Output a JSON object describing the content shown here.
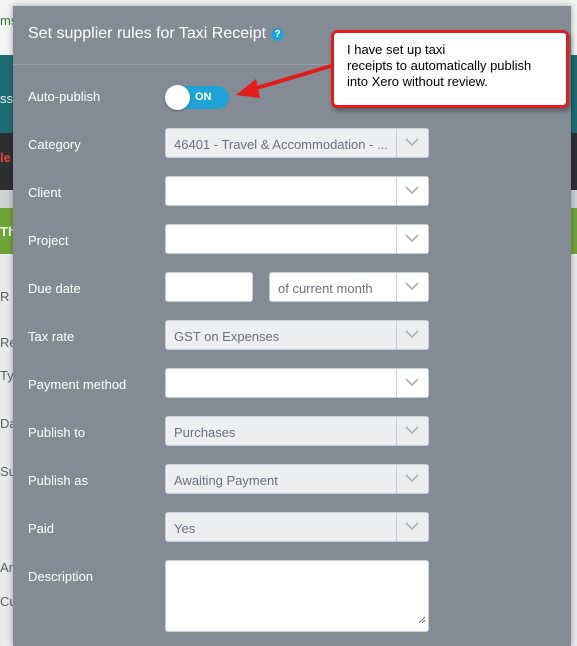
{
  "background": {
    "fragments": [
      "ms",
      "ss",
      "le",
      "Th",
      "R",
      "Re",
      "Typ",
      "Da",
      "Su",
      "An",
      "Cu"
    ]
  },
  "modal": {
    "title": "Set supplier rules for Taxi Receipt",
    "help_glyph": "?",
    "fields": {
      "auto_publish": {
        "label": "Auto-publish",
        "state": "ON"
      },
      "category": {
        "label": "Category",
        "value": "46401 - Travel & Accommodation - ..."
      },
      "client": {
        "label": "Client",
        "value": ""
      },
      "project": {
        "label": "Project",
        "value": ""
      },
      "due_date": {
        "label": "Due date",
        "value": "",
        "period": "of current month"
      },
      "tax_rate": {
        "label": "Tax rate",
        "value": "GST on Expenses"
      },
      "payment_method": {
        "label": "Payment method",
        "value": ""
      },
      "publish_to": {
        "label": "Publish to",
        "value": "Purchases"
      },
      "publish_as": {
        "label": "Publish as",
        "value": "Awaiting Payment"
      },
      "paid": {
        "label": "Paid",
        "value": "Yes"
      },
      "description": {
        "label": "Description",
        "value": ""
      }
    }
  },
  "callout": {
    "line1": "I have set up taxi",
    "line2": "receipts to automatically publish",
    "line3": "into Xero without review."
  },
  "colors": {
    "modal_bg": "#848b95",
    "toggle_on": "#1fa2d6",
    "callout_border": "#e21b1b"
  }
}
